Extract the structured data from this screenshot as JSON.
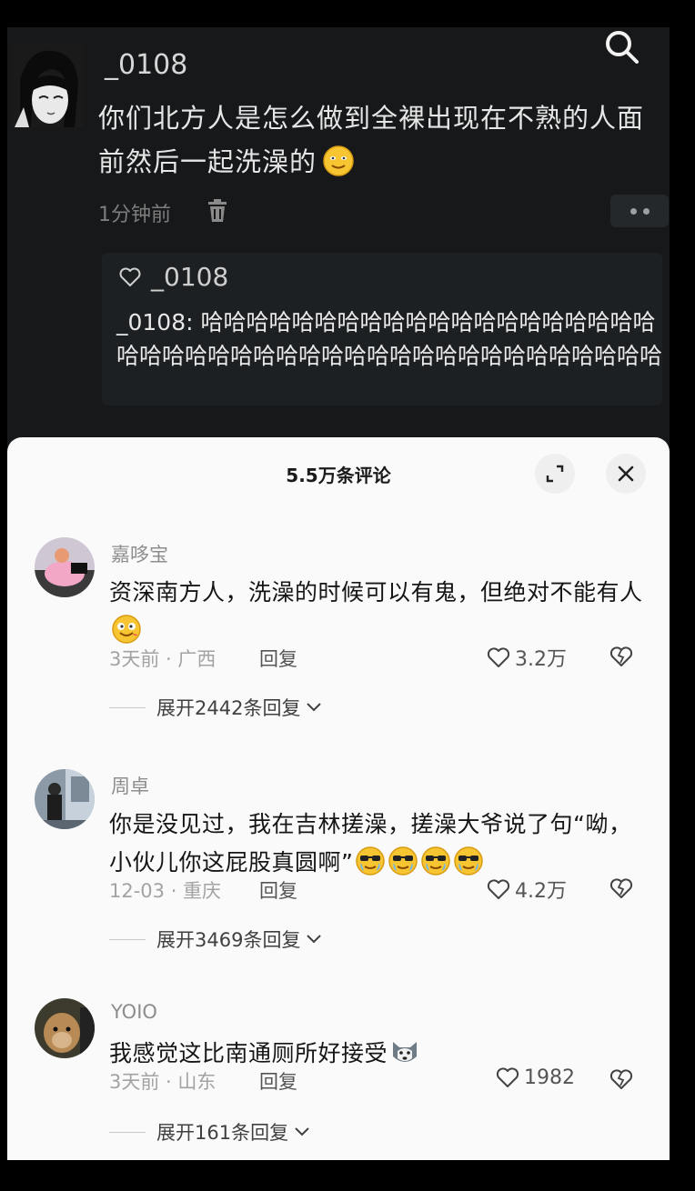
{
  "post": {
    "username": "_0108",
    "text": "你们北方人是怎么做到全裸出现在不熟的人面前然后一起洗澡的",
    "time": "1分钟前",
    "quote": {
      "username": "_0108",
      "text": "_0108: 哈哈哈哈哈哈哈哈哈哈哈哈哈哈哈哈哈哈哈哈哈哈哈哈哈哈哈哈哈哈哈哈哈哈哈哈哈哈哈哈哈哈哈哈"
    }
  },
  "sheet": {
    "title": "5.5万条评论"
  },
  "comments": [
    {
      "username": "嘉哆宝",
      "text": "资深南方人，洗澡的时候可以有鬼，但绝对不能有人",
      "meta": "3天前 · 广西",
      "reply": "回复",
      "likes": "3.2万",
      "expand": "展开2442条回复"
    },
    {
      "username": "周卓",
      "text": "你是没见过，我在吉林搓澡，搓澡大爷说了句“呦，小伙儿你这屁股真圆啊”",
      "meta": "12-03 · 重庆",
      "reply": "回复",
      "likes": "4.2万",
      "expand": "展开3469条回复"
    },
    {
      "username": "YOIO",
      "text": "我感觉这比南通厕所好接受",
      "meta": "3天前 · 山东",
      "reply": "回复",
      "likes": "1982",
      "expand": "展开161条回复"
    }
  ],
  "icons": {
    "search": "search-icon",
    "trash": "trash-icon",
    "more": "more-dots-icon",
    "heart": "heart-icon",
    "expand": "expand-icon",
    "close": "close-icon",
    "dislike": "broken-heart-icon",
    "chevron": "chevron-down-icon"
  },
  "colors": {
    "background_dark": "#161819",
    "sheet": "#fafafa",
    "text_dark": "#161616",
    "text_muted": "#a3a3a3"
  }
}
